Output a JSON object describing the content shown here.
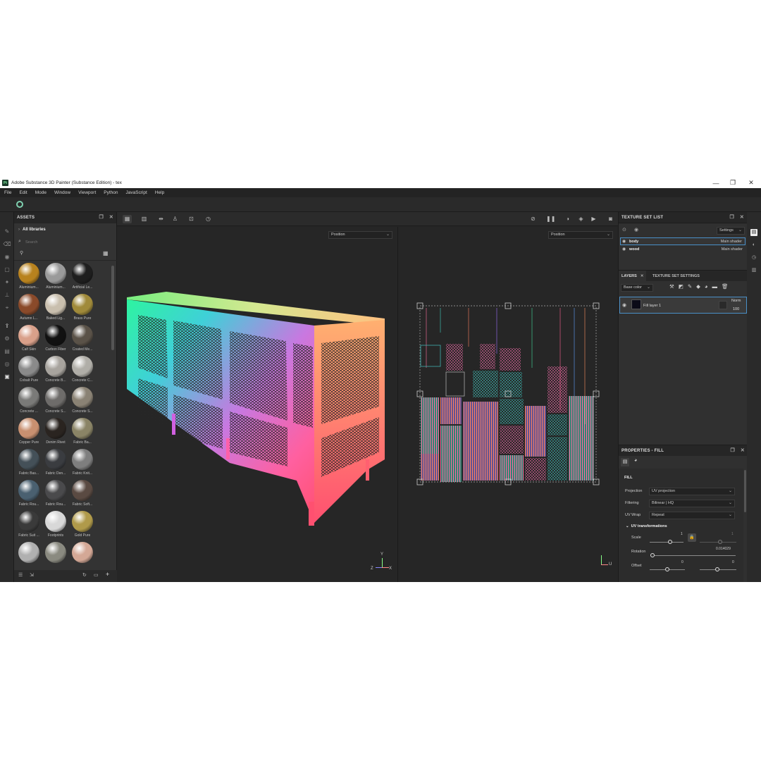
{
  "window": {
    "title": "Adobe Substance 3D Painter (Substance Edition) - tex",
    "logo_text": "Pt",
    "controls": {
      "minimize": "—",
      "maximize": "❐",
      "close": "✕"
    }
  },
  "menu": [
    "File",
    "Edit",
    "Mode",
    "Window",
    "Viewport",
    "Python",
    "JavaScript",
    "Help"
  ],
  "assets": {
    "header": "ASSETS",
    "library": "All libraries",
    "search_placeholder": "Search",
    "materials": [
      {
        "label": "Aluminium...",
        "color": "#b8821e"
      },
      {
        "label": "Aluminium...",
        "color": "#9a9a9a"
      },
      {
        "label": "Artificial Le...",
        "color": "#1e1e1e"
      },
      {
        "label": "Autumn L...",
        "color": "#8a4a2a"
      },
      {
        "label": "Baked Lig...",
        "color": "#c9bfae"
      },
      {
        "label": "Brass Pure",
        "color": "#a08a3a"
      },
      {
        "label": "Calf Skin",
        "color": "#d9a08a"
      },
      {
        "label": "Carbon Fiber",
        "color": "#111111"
      },
      {
        "label": "Coated Me...",
        "color": "#5a5248"
      },
      {
        "label": "Cobalt Pure",
        "color": "#8a8a8a"
      },
      {
        "label": "Concrete B...",
        "color": "#a8a49e"
      },
      {
        "label": "Concrete C...",
        "color": "#b0aea8"
      },
      {
        "label": "Concrete ...",
        "color": "#7a7a78"
      },
      {
        "label": "Concrete S...",
        "color": "#6e6c6a"
      },
      {
        "label": "Concrete S...",
        "color": "#8a8274"
      },
      {
        "label": "Copper Pure",
        "color": "#c89070"
      },
      {
        "label": "Denim Rivet",
        "color": "#2a2420"
      },
      {
        "label": "Fabric Ba...",
        "color": "#8a8466"
      },
      {
        "label": "Fabric Bas...",
        "color": "#445058"
      },
      {
        "label": "Fabric Den...",
        "color": "#3a3c40"
      },
      {
        "label": "Fabric Knit...",
        "color": "#7e7e7e"
      },
      {
        "label": "Fabric Rou...",
        "color": "#4a6070"
      },
      {
        "label": "Fabric Rou...",
        "color": "#4a4a4c"
      },
      {
        "label": "Fabric Soft...",
        "color": "#5a4a42"
      },
      {
        "label": "Fabric Suit ...",
        "color": "#3a3a3a"
      },
      {
        "label": "Footprints",
        "color": "#d8d8d8"
      },
      {
        "label": "Gold Pure",
        "color": "#b09a4a"
      },
      {
        "label": "",
        "color": "#b0b0b0"
      },
      {
        "label": "",
        "color": "#8a8a80"
      },
      {
        "label": "",
        "color": "#d4a896"
      }
    ]
  },
  "viewport": {
    "left_channel": "Position",
    "right_channel": "Position",
    "axes_3d": {
      "x": "X",
      "y": "Y",
      "z": "Z"
    },
    "axes_uv": {
      "u": "U"
    }
  },
  "texture_set_list": {
    "header": "TEXTURE SET LIST",
    "settings": "Settings",
    "items": [
      {
        "name": "body",
        "shader": "Main shader"
      },
      {
        "name": "wood",
        "shader": "Main shader"
      }
    ]
  },
  "layers": {
    "tab_layers": "LAYERS",
    "tab_settings": "TEXTURE SET SETTINGS",
    "channel": "Base color",
    "layer_name": "Fill layer 1",
    "blend": "Norm",
    "opacity": "100"
  },
  "properties": {
    "header": "PROPERTIES - FILL",
    "section": "FILL",
    "projection_label": "Projection",
    "projection_value": "UV projection",
    "filtering_label": "Filtering",
    "filtering_value": "Bilinear | HQ",
    "wrap_label": "UV Wrap",
    "wrap_value": "Repeat",
    "uv_section": "UV transformations",
    "scale_label": "Scale",
    "scale_value": "1",
    "scale_value2": "1",
    "rotation_label": "Rotation",
    "rotation_value": "0.014029",
    "offset_label": "Offset",
    "offset_x": "0",
    "offset_y": "0"
  }
}
